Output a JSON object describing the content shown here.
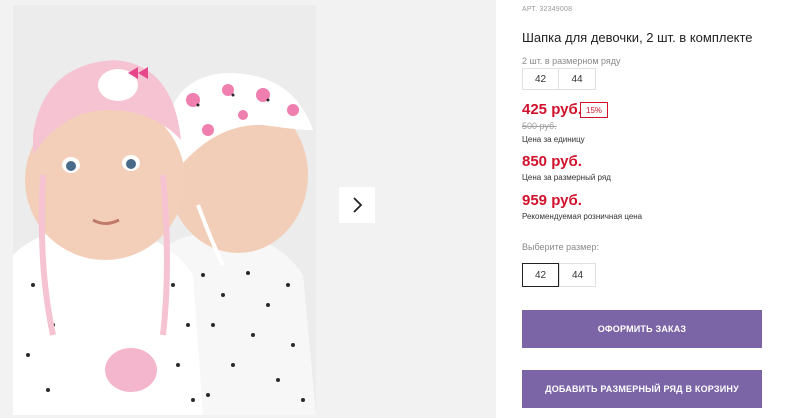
{
  "gallery": {
    "next_icon": "chevron-right-icon"
  },
  "product": {
    "article": "АРТ. 32349008",
    "title": "Шапка для девочки, 2 шт. в комплекте",
    "set_label": "2 шт. в размерном ряду",
    "set_sizes": [
      "42",
      "44"
    ],
    "price": "425 руб.",
    "discount": "15%",
    "old_price": "500 руб.",
    "price_note": "Цена за единицу",
    "set_price": "850 руб.",
    "set_price_note": "Цена за размерный ряд",
    "retail_price": "959 руб.",
    "retail_price_note": "Рекомендуемая розничная цена",
    "choose_label": "Выберите размер:",
    "choose_sizes": [
      "42",
      "44"
    ],
    "selected_size": "42"
  },
  "buttons": {
    "order": "ОФОРМИТЬ ЗАКАЗ",
    "add_set": "ДОБАВИТЬ РАЗМЕРНЫЙ РЯД В КОРЗИНУ"
  },
  "colors": {
    "accent": "#7b65a7",
    "price": "#d0122c"
  }
}
